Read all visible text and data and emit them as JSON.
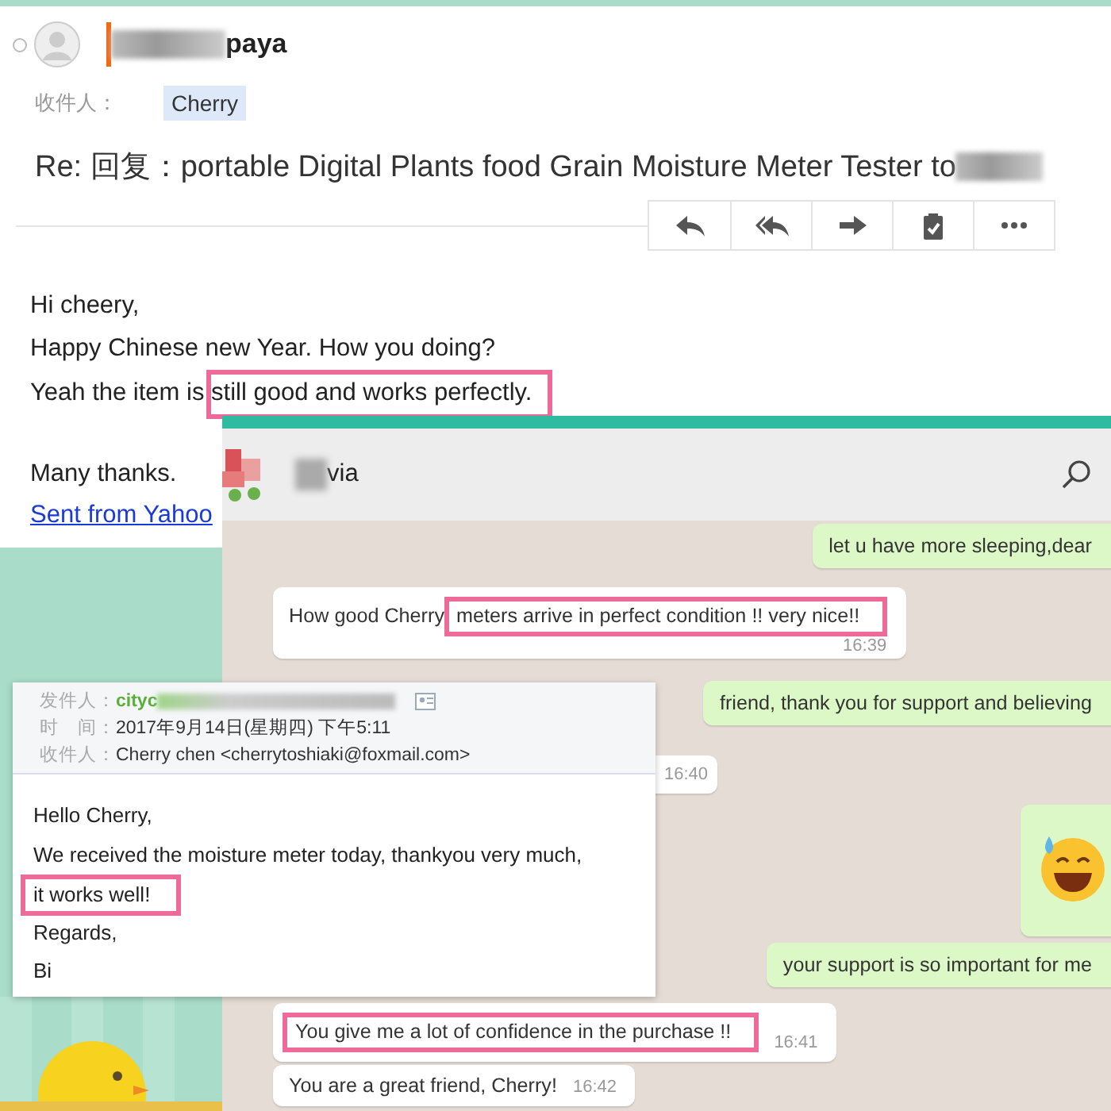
{
  "email_top": {
    "selected": false,
    "sender": "paya",
    "to_label": "收件人：",
    "recipient": "Cherry",
    "subject": "Re: 回复：portable Digital Plants food Grain Moisture Meter Tester to",
    "toolbar": [
      {
        "kind": "reply"
      },
      {
        "kind": "reply-all"
      },
      {
        "kind": "forward"
      },
      {
        "kind": "clipboard"
      },
      {
        "kind": "more"
      }
    ],
    "paragraphs": [
      [
        {
          "kind": "text",
          "text": "Hi cheery,"
        },
        {
          "kind": "text",
          "text": "Happy Chinese new Year. How you doing?"
        },
        {
          "kind": "text",
          "text": "Yeah the item is ",
          "highlight": "still good and works perfectly."
        }
      ],
      [
        {
          "kind": "text",
          "text": "Many thanks."
        },
        {
          "kind": "link",
          "text": "Sent from Yahoo"
        }
      ]
    ]
  },
  "chat": {
    "contact": "via",
    "messages": [
      {
        "kind": "text",
        "outgoing": true,
        "text": "let u have more sleeping,dear"
      },
      {
        "kind": "text",
        "outgoing": false,
        "text": "How good Cherry ",
        "highlight": "meters arrive in perfect condition !! very nice!!",
        "time": "16:39"
      },
      {
        "kind": "text",
        "outgoing": true,
        "text": "friend, thank you for support and believing"
      },
      {
        "kind": "time_only",
        "outgoing": false,
        "time": "16:40"
      },
      {
        "kind": "emoji",
        "outgoing": true
      },
      {
        "kind": "text",
        "outgoing": true,
        "text": "your support is so important for me"
      },
      {
        "kind": "text",
        "outgoing": false,
        "highlight": "You give me a lot of confidence in the purchase !!",
        "time": "16:41"
      },
      {
        "kind": "text",
        "outgoing": false,
        "text": "You are a great friend, Cherry!",
        "time": "16:42"
      }
    ]
  },
  "email_mini": {
    "from_label": "发件人：",
    "from": "cityc",
    "time_label": "时　间：",
    "time": "2017年9月14日(星期四) 下午5:11",
    "to_label": "收件人：",
    "to": "Cherry chen <cherrytoshiaki@foxmail.com>",
    "body": [
      {
        "text": "Hello Cherry,"
      },
      {
        "text": "We received the moisture meter today, thankyou very much,"
      },
      {
        "highlight": "it works well!"
      },
      {
        "text": "Regards,"
      },
      {
        "text": "Bi"
      }
    ]
  }
}
